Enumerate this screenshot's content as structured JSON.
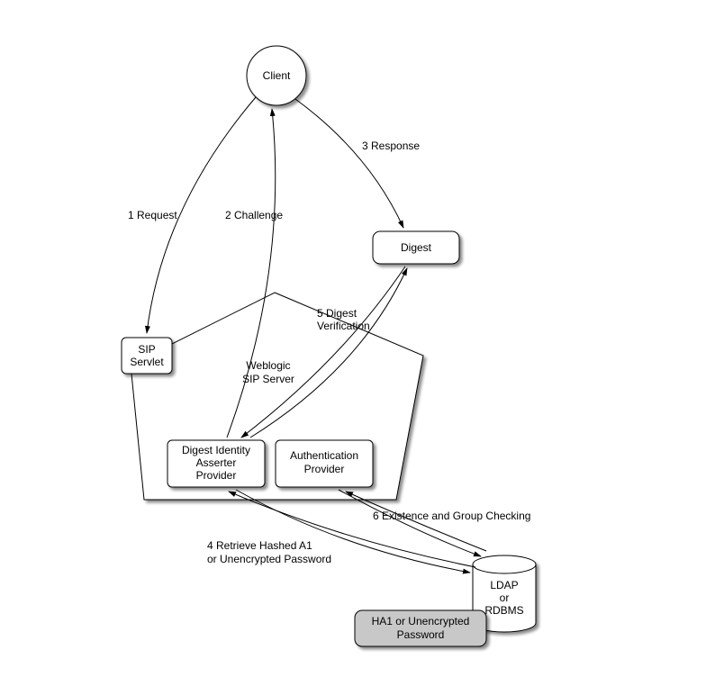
{
  "nodes": {
    "client": "Client",
    "digest": "Digest",
    "sip_servlet_l1": "SIP",
    "sip_servlet_l2": "Servlet",
    "weblogic_l1": "Weblogic",
    "weblogic_l2": "SIP Server",
    "dia_l1": "Digest Identity",
    "dia_l2": "Asserter",
    "dia_l3": "Provider",
    "auth_l1": "Authentication",
    "auth_l2": "Provider",
    "ldap_l1": "LDAP",
    "ldap_l2": "or",
    "ldap_l3": "RDBMS",
    "ha1_l1": "HA1 or Unencrypted",
    "ha1_l2": "Password"
  },
  "edges": {
    "request": "1 Request",
    "challenge": "2 Challenge",
    "response": "3 Response",
    "retrieve_l1": "4 Retrieve Hashed A1",
    "retrieve_l2": "or Unencrypted Password",
    "verify_l1": "5 Digest",
    "verify_l2": "Verification",
    "group": "6 Existence and Group Checking"
  }
}
